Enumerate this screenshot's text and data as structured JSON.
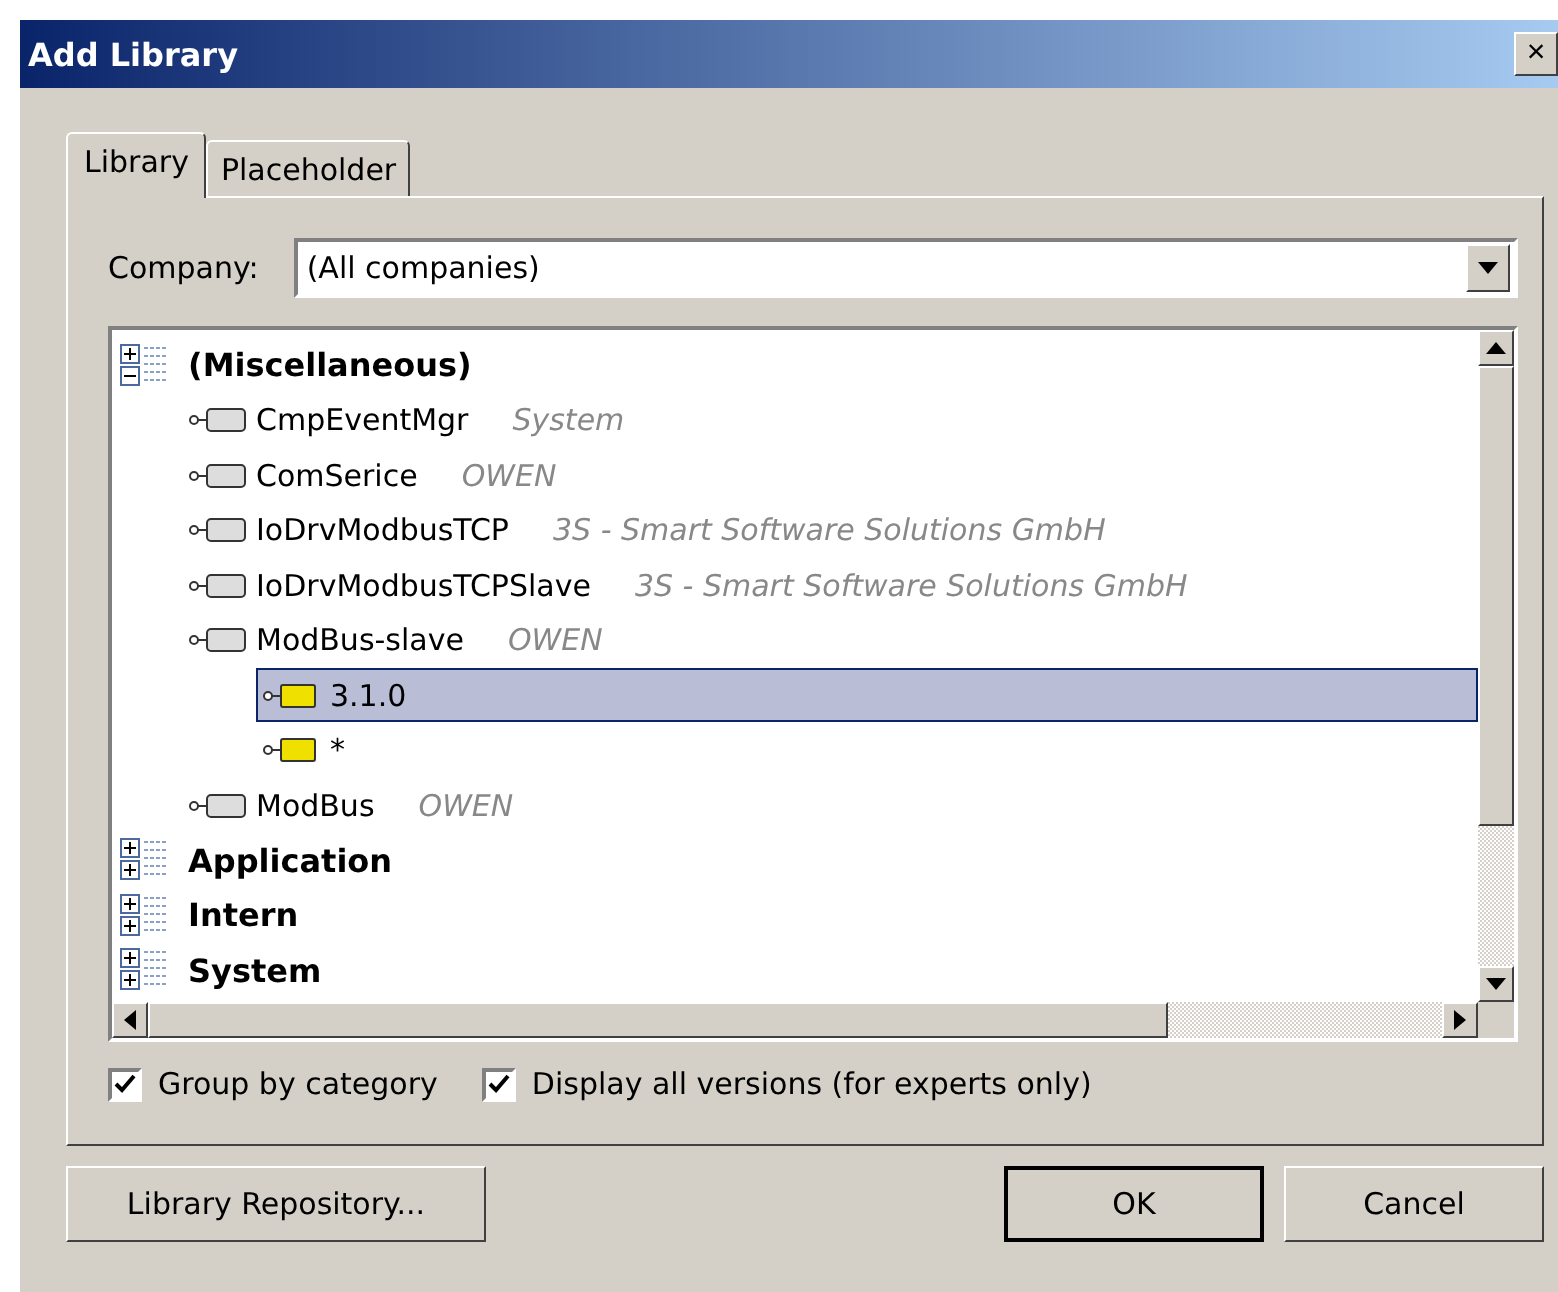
{
  "window": {
    "title": "Add Library",
    "close": "×"
  },
  "tabs": [
    {
      "label": "Library",
      "selected": true
    },
    {
      "label": "Placeholder",
      "selected": false
    }
  ],
  "company": {
    "label": "Company:",
    "value": "(All companies)"
  },
  "tree": [
    {
      "kind": "group",
      "label": "(Miscellaneous)",
      "expanded": true,
      "children": [
        {
          "kind": "library",
          "label": "CmpEventMgr",
          "vendor": "System"
        },
        {
          "kind": "library",
          "label": "ComSerice",
          "vendor": "OWEN"
        },
        {
          "kind": "library",
          "label": "IoDrvModbusTCP",
          "vendor": "3S - Smart Software Solutions GmbH"
        },
        {
          "kind": "library",
          "label": "IoDrvModbusTCPSlave",
          "vendor": "3S - Smart Software Solutions GmbH"
        },
        {
          "kind": "library",
          "label": "ModBus-slave",
          "vendor": "OWEN",
          "children": [
            {
              "kind": "version",
              "label": "3.1.0",
              "selected": true
            },
            {
              "kind": "version",
              "label": "*",
              "selected": false
            }
          ]
        },
        {
          "kind": "library",
          "label": "ModBus",
          "vendor": "OWEN"
        }
      ]
    },
    {
      "kind": "group",
      "label": "Application",
      "expanded": false
    },
    {
      "kind": "group",
      "label": "Intern",
      "expanded": false
    },
    {
      "kind": "group",
      "label": "System",
      "expanded": false
    }
  ],
  "options": [
    {
      "label": "Group by category",
      "checked": true
    },
    {
      "label": "Display all versions (for experts only)",
      "checked": true
    }
  ],
  "buttons": [
    {
      "label": "Library Repository...",
      "default": false
    },
    {
      "label": "OK",
      "default": true
    },
    {
      "label": "Cancel",
      "default": false
    }
  ]
}
